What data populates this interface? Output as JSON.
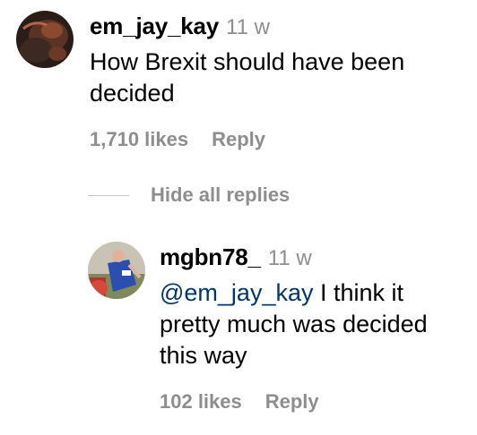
{
  "comment": {
    "username": "em_jay_kay",
    "time": "11 w",
    "text_line1": "How Brexit should have been",
    "text_line2": "decided",
    "likes": "1,710 likes",
    "reply_label": "Reply"
  },
  "replies_toggle": {
    "label": "Hide all replies"
  },
  "reply": {
    "username": "mgbn78_",
    "time": "11 w",
    "mention": "@em_jay_kay",
    "text_line1_rest": " I think it",
    "text_line2": "pretty much was decided",
    "text_line3": "this way",
    "likes": "102 likes",
    "reply_label": "Reply"
  },
  "colors": {
    "meta_gray": "#8e8e8e",
    "mention_blue": "#00376b",
    "divider_gray": "#c7c7c7"
  }
}
